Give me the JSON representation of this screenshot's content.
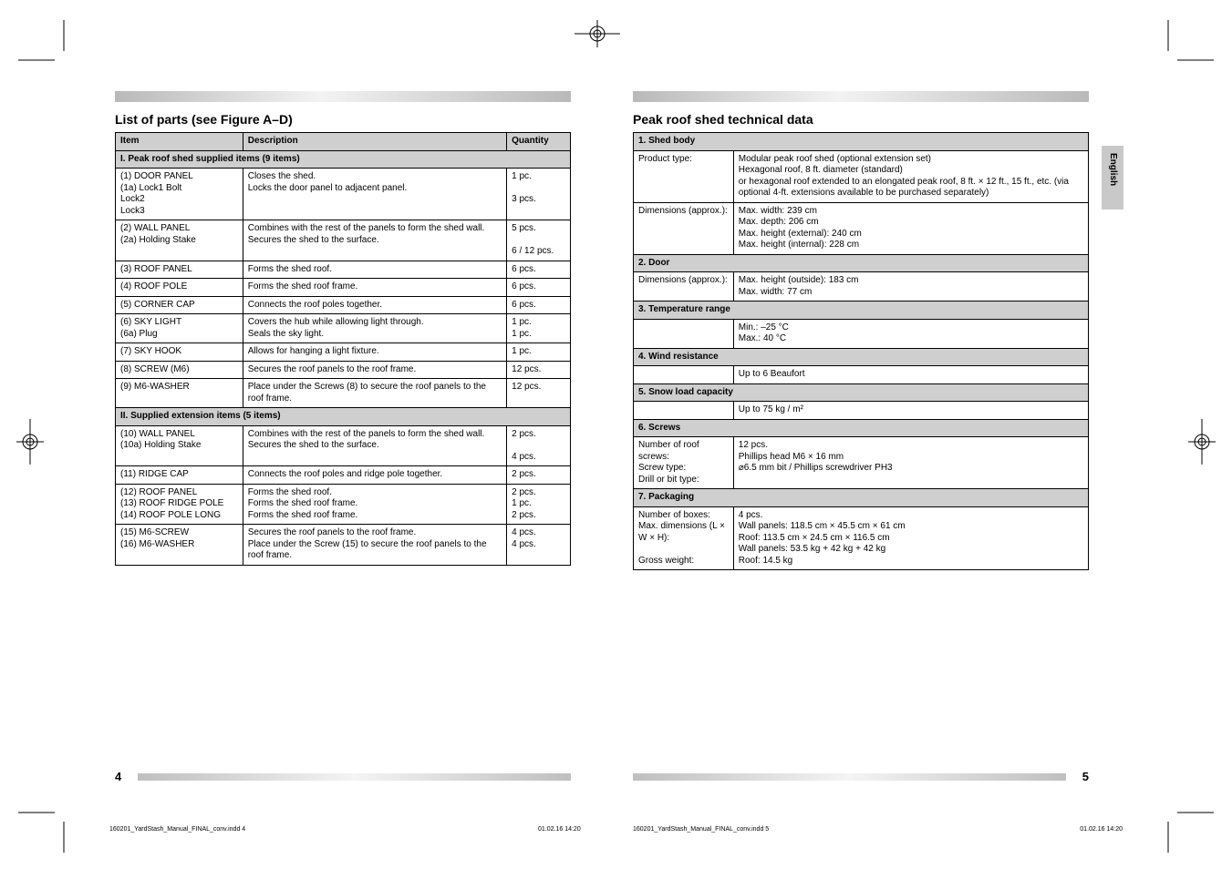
{
  "sidetab": "English",
  "left": {
    "title": "List of parts (see Figure A–D)",
    "header": {
      "c1": "Item",
      "c2": "Description",
      "c3": "Quantity"
    },
    "sub1": "I. Peak roof shed supplied items (9 items)",
    "rows1": [
      {
        "a": "(1) DOOR PANEL\n(1a) Lock1 Bolt\nLock2\nLock3",
        "b": "Closes the shed.\nLocks the door panel to adjacent panel.",
        "c": "1 pc.",
        "locks": "3 pcs."
      },
      {
        "a": "(2) WALL PANEL\n(2a) Holding Stake",
        "b": "Combines with the rest of the panels to form the shed wall.\nSecures the shed to the surface.",
        "c": "5 pcs.\n\n6 / 12 pcs."
      },
      {
        "a": "(3) ROOF PANEL",
        "b": "Forms the shed roof.",
        "c": "6 pcs."
      },
      {
        "a": "(4) ROOF POLE",
        "b": "Forms the shed roof frame.",
        "c": "6 pcs."
      },
      {
        "a": "(5) CORNER CAP",
        "b": "Connects the roof poles together.",
        "c": "6 pcs."
      },
      {
        "a": "(6) SKY LIGHT\n(6a) Plug",
        "b": "Covers the hub while allowing light through.\nSeals the sky light.",
        "c": "1 pc.\n1 pc."
      },
      {
        "a": "(7) SKY HOOK",
        "b": "Allows for hanging a light fixture.",
        "c": "1 pc."
      },
      {
        "a": "(8) SCREW (M6)",
        "b": "Secures the roof panels to the roof frame.",
        "c": "12 pcs."
      },
      {
        "a": "(9) M6-WASHER",
        "b": "Place under the Screws (8) to secure the roof panels to the roof frame.",
        "c": "12 pcs."
      }
    ],
    "sub2": "II. Supplied extension items (5 items)",
    "rows2": [
      {
        "a": "(10) WALL PANEL\n(10a) Holding Stake",
        "b": "Combines with the rest of the panels to form the shed wall.\nSecures the shed to the surface.",
        "c": "2 pcs.\n\n4 pcs."
      },
      {
        "a": "(11) RIDGE CAP",
        "b": "Connects the roof poles and ridge pole together.",
        "c": "2 pcs."
      },
      {
        "a": "(12) ROOF PANEL\n(13) ROOF RIDGE POLE\n(14) ROOF POLE LONG",
        "b": "Forms the shed roof.\nForms the shed roof frame.\nForms the shed roof frame.",
        "c": "2 pcs.\n1 pc.\n2 pcs."
      },
      {
        "a": "(15) M6-SCREW\n(16) M6-WASHER",
        "b": "Secures the roof panels to the roof frame.\nPlace under the Screw (15) to secure the roof panels to the roof frame.",
        "c": "4 pcs.\n4 pcs."
      }
    ],
    "pagenum": "4"
  },
  "right": {
    "title": "Peak roof shed technical data",
    "rows": [
      {
        "h": "1. Shed body",
        "a": "Product type:",
        "b": "Modular peak roof shed (optional extension set)\nHexagonal roof, 8 ft. diameter (standard)\nor hexagonal roof extended to an elongated peak roof, 8 ft. × 12 ft., 15 ft., etc. (via optional 4-ft. extensions available to be purchased separately)"
      },
      {
        "h": "",
        "a": "Dimensions (approx.):",
        "b": "Max. width: 239 cm\nMax. depth: 206 cm\nMax. height (external): 240 cm\nMax. height (internal): 228 cm"
      },
      {
        "h": "2. Door",
        "a": "Dimensions (approx.):",
        "b": "Max. height (outside): 183 cm\nMax. width: 77 cm"
      },
      {
        "h": "3. Temperature range",
        "a": "",
        "b": "Min.: –25 °C\nMax.: 40 °C"
      },
      {
        "h": "4. Wind resistance",
        "a": "",
        "b": "Up to 6 Beaufort"
      },
      {
        "h": "5. Snow load capacity",
        "a": "",
        "b": "Up to 75 kg / m²"
      },
      {
        "h": "6. Screws",
        "a": "Number of roof screws:\nScrew type:\nDrill or bit type:",
        "b": "12 pcs.\nPhillips head M6 × 16 mm\n⌀6.5 mm bit / Phillips screwdriver PH3"
      },
      {
        "h": "7. Packaging",
        "a": "Number of boxes:\nMax. dimensions (L × W × H):\n\nGross weight:",
        "b": "4 pcs.\nWall panels: 118.5 cm × 45.5 cm × 61 cm\nRoof: 113.5 cm × 24.5 cm × 116.5 cm\nWall panels: 53.5 kg + 42 kg + 42 kg\nRoof: 14.5 kg"
      }
    ],
    "pagenum": "5"
  },
  "slugL": "160201_YardStash_Manual_FINAL_conv.indd   4",
  "slugLTime": "01.02.16   14:20",
  "slugR": "160201_YardStash_Manual_FINAL_conv.indd   5",
  "slugRTime": "01.02.16   14:20"
}
